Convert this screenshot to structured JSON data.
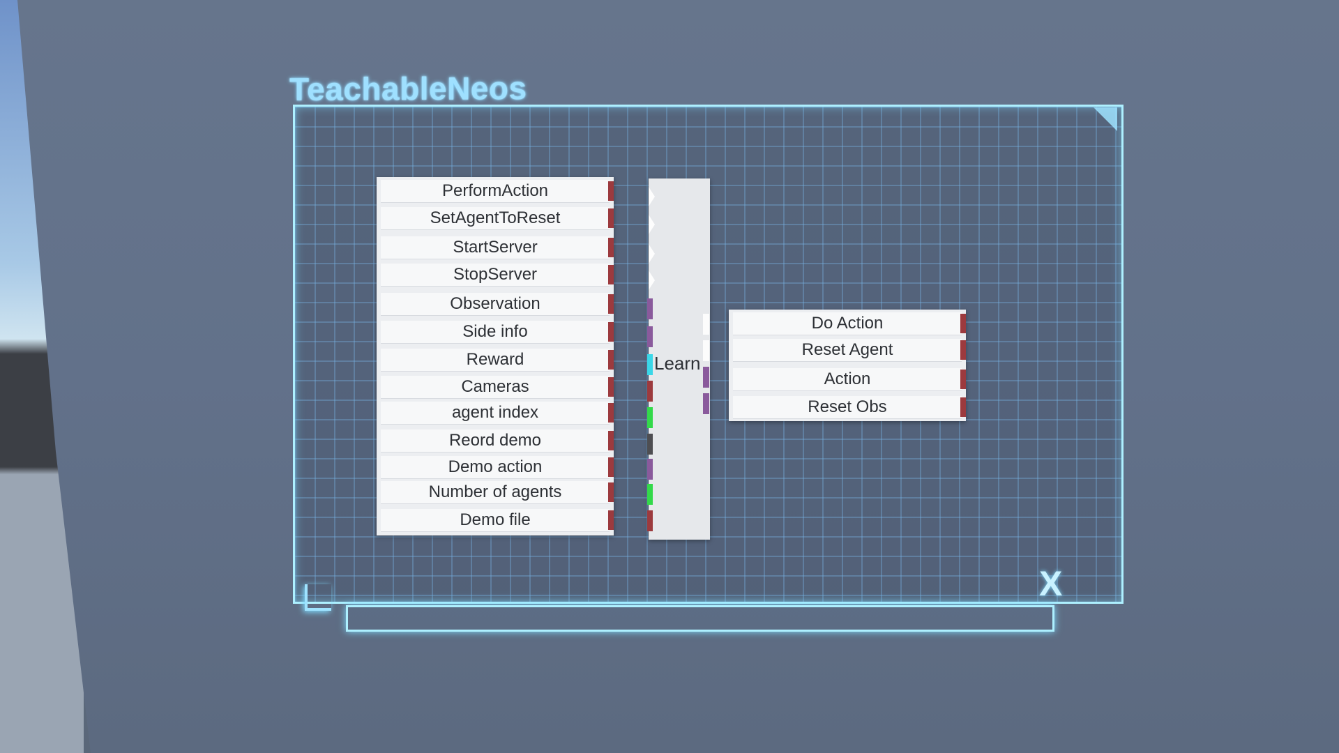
{
  "window": {
    "title": "TeachableNeos",
    "close_label": "X"
  },
  "inputs": [
    {
      "label": "PerformAction"
    },
    {
      "label": "SetAgentToReset"
    },
    {
      "label": "StartServer"
    },
    {
      "label": "StopServer"
    },
    {
      "label": "Observation"
    },
    {
      "label": "Side info"
    },
    {
      "label": "Reward"
    },
    {
      "label": "Cameras"
    },
    {
      "label": "agent index"
    },
    {
      "label": "Reord demo"
    },
    {
      "label": "Demo action"
    },
    {
      "label": "Number of agents"
    },
    {
      "label": "Demo file"
    }
  ],
  "node": {
    "label": "Learn"
  },
  "outputs": [
    {
      "label": "Do Action"
    },
    {
      "label": "Reset Agent"
    },
    {
      "label": "Action"
    },
    {
      "label": "Reset Obs"
    }
  ],
  "colors": {
    "panel_border": "#aef0ff",
    "port_red": "#9c3a3e",
    "port_purple": "#8a5a9c",
    "port_cyan": "#3ad7e8",
    "port_green": "#33d94a",
    "port_dark": "#4e4e52"
  }
}
